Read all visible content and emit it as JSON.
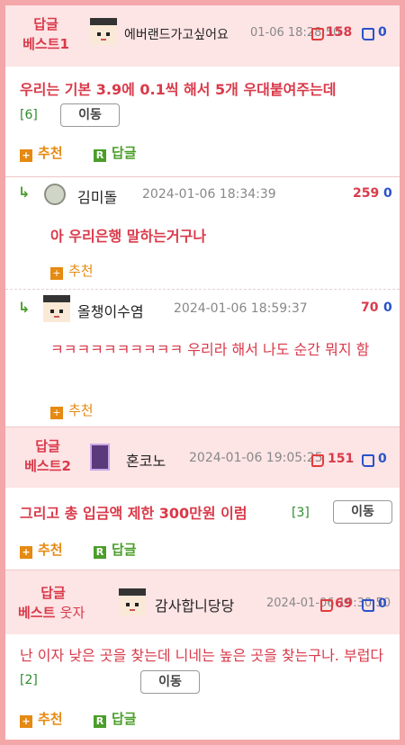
{
  "posts": [
    {
      "badge_line1": "답글",
      "badge_line2": "베스트1",
      "nickname": "에버랜드가고싶어요",
      "date": "01-06 18:28:50",
      "up": "158",
      "down": "0",
      "title": "우리는 기본 3.9에 0.1씩 해서 5개 우대붙여주는데",
      "comment_count": "[6]",
      "move_label": "이동",
      "recommend_label": "추천",
      "reply_label": "답글",
      "replies": [
        {
          "nickname": "김미돌",
          "date": "2024-01-06 18:34:39",
          "up": "259",
          "down": "0",
          "text": "아 우리은행 말하는거구나",
          "recommend_label": "추천"
        },
        {
          "nickname": "올챙이수염",
          "date": "2024-01-06 18:59:37",
          "up": "70",
          "down": "0",
          "text": "ㅋㅋㅋㅋㅋㅋㅋㅋㅋㅋ 우리라 해서 나도 순간 뭐지 함",
          "recommend_label": "추천"
        }
      ]
    },
    {
      "badge_line1": "답글",
      "badge_line2": "베스트2",
      "nickname": "혼코노",
      "date": "2024-01-06 19:05:25",
      "up": "151",
      "down": "0",
      "title": "그리고 총 입금액 제한 300만원 이럼",
      "comment_count": "[3]",
      "move_label": "이동",
      "recommend_label": "추천",
      "reply_label": "답글"
    },
    {
      "badge_line1": "답글",
      "badge_line2": "베스트",
      "badge_suffix": "웃자",
      "nickname": "감사합니당당",
      "date": "2024-01-06 19:30:50",
      "up": "69",
      "down": "0",
      "title": "난 이자 낮은 곳을 찾는데 니네는 높은 곳을 찾는구나. 부럽다",
      "comment_count": "[2]",
      "move_label": "이동",
      "recommend_label": "추천",
      "reply_label": "답글"
    }
  ],
  "icons": {
    "plus": "+",
    "reply_badge": "R",
    "reply_arrow": "↳"
  },
  "colors": {
    "accent_red": "#d93a4a",
    "header_bg": "#fde4e5",
    "border_pink": "#f4a7a9",
    "recommend_orange": "#e58a12",
    "reply_green": "#4b9e2a",
    "down_blue": "#2a52c9"
  }
}
